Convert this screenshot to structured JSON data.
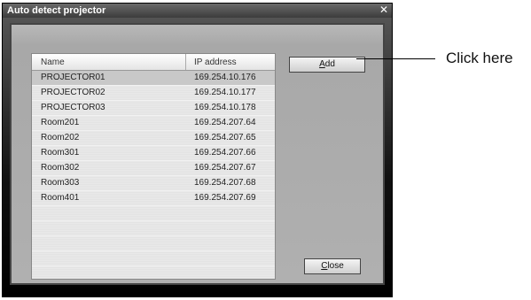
{
  "window": {
    "title": "Auto detect projector",
    "close_glyph": "✕"
  },
  "list": {
    "columns": [
      "Name",
      "IP address"
    ],
    "rows": [
      {
        "name": "PROJECTOR01",
        "ip": "169.254.10.176",
        "selected": true
      },
      {
        "name": "PROJECTOR02",
        "ip": "169.254.10.177",
        "selected": false
      },
      {
        "name": "PROJECTOR03",
        "ip": "169.254.10.178",
        "selected": false
      },
      {
        "name": "Room201",
        "ip": "169.254.207.64",
        "selected": false
      },
      {
        "name": "Room202",
        "ip": "169.254.207.65",
        "selected": false
      },
      {
        "name": "Room301",
        "ip": "169.254.207.66",
        "selected": false
      },
      {
        "name": "Room302",
        "ip": "169.254.207.67",
        "selected": false
      },
      {
        "name": "Room303",
        "ip": "169.254.207.68",
        "selected": false
      },
      {
        "name": "Room401",
        "ip": "169.254.207.69",
        "selected": false
      }
    ]
  },
  "buttons": {
    "add_label": "Add",
    "add_accel": "A",
    "close_label": "Close",
    "close_accel": "C"
  },
  "callout": {
    "text": "Click here"
  }
}
